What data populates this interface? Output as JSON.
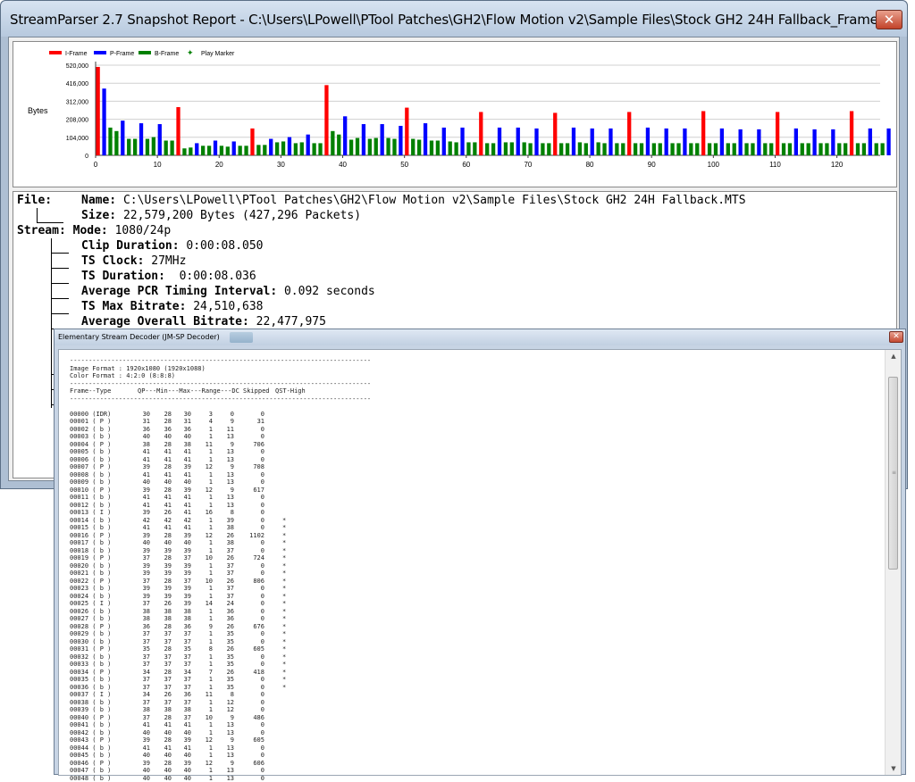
{
  "main_window": {
    "title": "StreamParser 2.7 Snapshot Report - C:\\Users\\LPowell\\PTool Patches\\GH2\\Flow Motion v2\\Sample Files\\Stock GH2 24H Fallback_Frames",
    "close_label": "✕"
  },
  "colors": {
    "i_frame": "#ff0000",
    "p_frame": "#0000ff",
    "b_frame": "#008000",
    "play_marker": "#008000"
  },
  "chart_data": {
    "type": "bar",
    "ylabel": "Bytes",
    "legend": [
      "I-Frame",
      "P-Frame",
      "B-Frame",
      "Play Marker"
    ],
    "legend_position": "top-left",
    "y_ticks": [
      "520,000",
      "416,000",
      "312,000",
      "208,000",
      "104,000",
      "0"
    ],
    "y_tick_values": [
      520000,
      416000,
      312000,
      208000,
      104000,
      0
    ],
    "x_ticks": [
      "0",
      "10",
      "20",
      "30",
      "40",
      "50",
      "60",
      "70",
      "80",
      "90",
      "100",
      "110",
      "120"
    ],
    "x_tick_values": [
      0,
      10,
      20,
      30,
      40,
      50,
      60,
      70,
      80,
      90,
      100,
      110,
      120
    ],
    "ylim": [
      0,
      520000
    ],
    "xlim": [
      0,
      127
    ],
    "grid": "horizontal",
    "frame_types": [
      "I",
      "P",
      "B",
      "B",
      "P",
      "B",
      "B",
      "P",
      "B",
      "B",
      "P",
      "B",
      "B",
      "I",
      "B",
      "B",
      "P",
      "B",
      "B",
      "P",
      "B",
      "B",
      "P",
      "B",
      "B",
      "I",
      "B",
      "B",
      "P",
      "B",
      "B",
      "P",
      "B",
      "B",
      "P",
      "B",
      "B",
      "I",
      "B",
      "B",
      "P",
      "B",
      "B",
      "P",
      "B",
      "B",
      "P",
      "B",
      "B",
      "P",
      "I",
      "B",
      "B",
      "P",
      "B",
      "B",
      "P",
      "B",
      "B",
      "P",
      "B",
      "B",
      "I",
      "B",
      "B",
      "P",
      "B",
      "B",
      "P",
      "B",
      "B",
      "P",
      "B",
      "B",
      "I",
      "B",
      "B",
      "P",
      "B",
      "B",
      "P",
      "B",
      "B",
      "P",
      "B",
      "B",
      "I",
      "B",
      "B",
      "P",
      "B",
      "B",
      "P",
      "B",
      "B",
      "P",
      "B",
      "B",
      "I",
      "B",
      "B",
      "P",
      "B",
      "B",
      "P",
      "B",
      "B",
      "P",
      "B",
      "B",
      "I",
      "B",
      "B",
      "P",
      "B",
      "B",
      "P",
      "B",
      "B",
      "P",
      "B",
      "B",
      "I",
      "B",
      "B",
      "P",
      "B",
      "B",
      "P"
    ],
    "values": [
      510000,
      385000,
      160000,
      140000,
      200000,
      95000,
      95000,
      185000,
      95000,
      105000,
      180000,
      85000,
      85000,
      278000,
      40000,
      45000,
      70000,
      55000,
      55000,
      85000,
      55000,
      50000,
      80000,
      55000,
      55000,
      155000,
      60000,
      60000,
      95000,
      75000,
      80000,
      105000,
      70000,
      75000,
      120000,
      70000,
      70000,
      405000,
      140000,
      120000,
      225000,
      90000,
      100000,
      180000,
      95000,
      100000,
      180000,
      100000,
      95000,
      170000,
      275000,
      95000,
      90000,
      185000,
      85000,
      85000,
      160000,
      80000,
      75000,
      160000,
      75000,
      75000,
      250000,
      70000,
      70000,
      160000,
      75000,
      75000,
      160000,
      75000,
      70000,
      155000,
      70000,
      70000,
      245000,
      70000,
      70000,
      160000,
      75000,
      70000,
      155000,
      75000,
      70000,
      155000,
      70000,
      70000,
      250000,
      70000,
      70000,
      160000,
      70000,
      70000,
      155000,
      70000,
      70000,
      155000,
      70000,
      70000,
      255000,
      70000,
      70000,
      155000,
      70000,
      70000,
      150000,
      70000,
      70000,
      150000,
      70000,
      70000,
      250000,
      70000,
      70000,
      155000,
      70000,
      70000,
      150000,
      70000,
      70000,
      150000,
      70000,
      70000,
      255000,
      70000,
      70000,
      155000,
      70000,
      70000,
      155000
    ]
  },
  "info": {
    "file_label": "File:",
    "name_label": "Name:",
    "name_value": "C:\\Users\\LPowell\\PTool Patches\\GH2\\Flow Motion v2\\Sample Files\\Stock GH2 24H Fallback.MTS",
    "size_label": "Size:",
    "size_value": "22,579,200 Bytes (427,296 Packets)",
    "stream_label": "Stream:",
    "mode_label": "Mode:",
    "mode_value": "1080/24p",
    "clip_duration_label": "Clip Duration:",
    "clip_duration_value": "0:00:08.050",
    "ts_clock_label": "TS Clock:",
    "ts_clock_value": "27MHz",
    "ts_duration_label": "TS Duration:",
    "ts_duration_value": "0:00:08.036",
    "avg_pcr_label": "Average PCR Timing Interval:",
    "avg_pcr_value": "0.092 seconds",
    "ts_max_label": "TS Max Bitrate:",
    "ts_max_value": "24,510,638",
    "avg_overall_label": "Average Overall Bitrate:",
    "avg_overall_value": "22,477,975"
  },
  "decoder": {
    "title": "Elementary Stream Decoder (JM-SP Decoder)",
    "close_label": "✕",
    "separator": "--------------------------------------------------------------------------------",
    "image_format": "Image Format : 1920x1080 (1920x1088)",
    "color_format": "Color Format : 4:2:0 (8:8:8)",
    "header": [
      "Frame--Type",
      "QP---Min---Max---Range---DC",
      "Skipped",
      "QST-High"
    ],
    "rows": [
      [
        "00000 (IDR)",
        "30",
        "28",
        "30",
        "3",
        "0",
        "0",
        ""
      ],
      [
        "00001 ( P )",
        "31",
        "28",
        "31",
        "4",
        "9",
        "31",
        ""
      ],
      [
        "00002 ( b )",
        "36",
        "36",
        "36",
        "1",
        "11",
        "0",
        ""
      ],
      [
        "00003 ( b )",
        "40",
        "40",
        "40",
        "1",
        "13",
        "0",
        ""
      ],
      [
        "00004 ( P )",
        "38",
        "28",
        "38",
        "11",
        "9",
        "706",
        ""
      ],
      [
        "00005 ( b )",
        "41",
        "41",
        "41",
        "1",
        "13",
        "0",
        ""
      ],
      [
        "00006 ( b )",
        "41",
        "41",
        "41",
        "1",
        "13",
        "0",
        ""
      ],
      [
        "00007 ( P )",
        "39",
        "28",
        "39",
        "12",
        "9",
        "708",
        ""
      ],
      [
        "00008 ( b )",
        "41",
        "41",
        "41",
        "1",
        "13",
        "0",
        ""
      ],
      [
        "00009 ( b )",
        "40",
        "40",
        "40",
        "1",
        "13",
        "0",
        ""
      ],
      [
        "00010 ( P )",
        "39",
        "28",
        "39",
        "12",
        "9",
        "617",
        ""
      ],
      [
        "00011 ( b )",
        "41",
        "41",
        "41",
        "1",
        "13",
        "0",
        ""
      ],
      [
        "00012 ( b )",
        "41",
        "41",
        "41",
        "1",
        "13",
        "0",
        ""
      ],
      [
        "00013 ( I )",
        "39",
        "26",
        "41",
        "16",
        "8",
        "0",
        ""
      ],
      [
        "00014 ( b )",
        "42",
        "42",
        "42",
        "1",
        "39",
        "0",
        "*"
      ],
      [
        "00015 ( b )",
        "41",
        "41",
        "41",
        "1",
        "38",
        "0",
        "*"
      ],
      [
        "00016 ( P )",
        "39",
        "28",
        "39",
        "12",
        "26",
        "1102",
        "*"
      ],
      [
        "00017 ( b )",
        "40",
        "40",
        "40",
        "1",
        "38",
        "0",
        "*"
      ],
      [
        "00018 ( b )",
        "39",
        "39",
        "39",
        "1",
        "37",
        "0",
        "*"
      ],
      [
        "00019 ( P )",
        "37",
        "28",
        "37",
        "10",
        "26",
        "724",
        "*"
      ],
      [
        "00020 ( b )",
        "39",
        "39",
        "39",
        "1",
        "37",
        "0",
        "*"
      ],
      [
        "00021 ( b )",
        "39",
        "39",
        "39",
        "1",
        "37",
        "0",
        "*"
      ],
      [
        "00022 ( P )",
        "37",
        "28",
        "37",
        "10",
        "26",
        "806",
        "*"
      ],
      [
        "00023 ( b )",
        "39",
        "39",
        "39",
        "1",
        "37",
        "0",
        "*"
      ],
      [
        "00024 ( b )",
        "39",
        "39",
        "39",
        "1",
        "37",
        "0",
        "*"
      ],
      [
        "00025 ( I )",
        "37",
        "26",
        "39",
        "14",
        "24",
        "0",
        "*"
      ],
      [
        "00026 ( b )",
        "38",
        "38",
        "38",
        "1",
        "36",
        "0",
        "*"
      ],
      [
        "00027 ( b )",
        "38",
        "38",
        "38",
        "1",
        "36",
        "0",
        "*"
      ],
      [
        "00028 ( P )",
        "36",
        "28",
        "36",
        "9",
        "26",
        "676",
        "*"
      ],
      [
        "00029 ( b )",
        "37",
        "37",
        "37",
        "1",
        "35",
        "0",
        "*"
      ],
      [
        "00030 ( b )",
        "37",
        "37",
        "37",
        "1",
        "35",
        "0",
        "*"
      ],
      [
        "00031 ( P )",
        "35",
        "28",
        "35",
        "8",
        "26",
        "605",
        "*"
      ],
      [
        "00032 ( b )",
        "37",
        "37",
        "37",
        "1",
        "35",
        "0",
        "*"
      ],
      [
        "00033 ( b )",
        "37",
        "37",
        "37",
        "1",
        "35",
        "0",
        "*"
      ],
      [
        "00034 ( P )",
        "34",
        "28",
        "34",
        "7",
        "26",
        "418",
        "*"
      ],
      [
        "00035 ( b )",
        "37",
        "37",
        "37",
        "1",
        "35",
        "0",
        "*"
      ],
      [
        "00036 ( b )",
        "37",
        "37",
        "37",
        "1",
        "35",
        "0",
        "*"
      ],
      [
        "00037 ( I )",
        "34",
        "26",
        "36",
        "11",
        "8",
        "0",
        ""
      ],
      [
        "00038 ( b )",
        "37",
        "37",
        "37",
        "1",
        "12",
        "0",
        ""
      ],
      [
        "00039 ( b )",
        "38",
        "38",
        "38",
        "1",
        "12",
        "0",
        ""
      ],
      [
        "00040 ( P )",
        "37",
        "28",
        "37",
        "10",
        "9",
        "486",
        ""
      ],
      [
        "00041 ( b )",
        "41",
        "41",
        "41",
        "1",
        "13",
        "0",
        ""
      ],
      [
        "00042 ( b )",
        "40",
        "40",
        "40",
        "1",
        "13",
        "0",
        ""
      ],
      [
        "00043 ( P )",
        "39",
        "28",
        "39",
        "12",
        "9",
        "605",
        ""
      ],
      [
        "00044 ( b )",
        "41",
        "41",
        "41",
        "1",
        "13",
        "0",
        ""
      ],
      [
        "00045 ( b )",
        "40",
        "40",
        "40",
        "1",
        "13",
        "0",
        ""
      ],
      [
        "00046 ( P )",
        "39",
        "28",
        "39",
        "12",
        "9",
        "606",
        ""
      ],
      [
        "00047 ( b )",
        "40",
        "40",
        "40",
        "1",
        "13",
        "0",
        ""
      ],
      [
        "00048 ( b )",
        "40",
        "40",
        "40",
        "1",
        "13",
        "0",
        ""
      ]
    ],
    "scroll_up": "▲",
    "scroll_down": "▼",
    "scroll_grip": "≡"
  }
}
